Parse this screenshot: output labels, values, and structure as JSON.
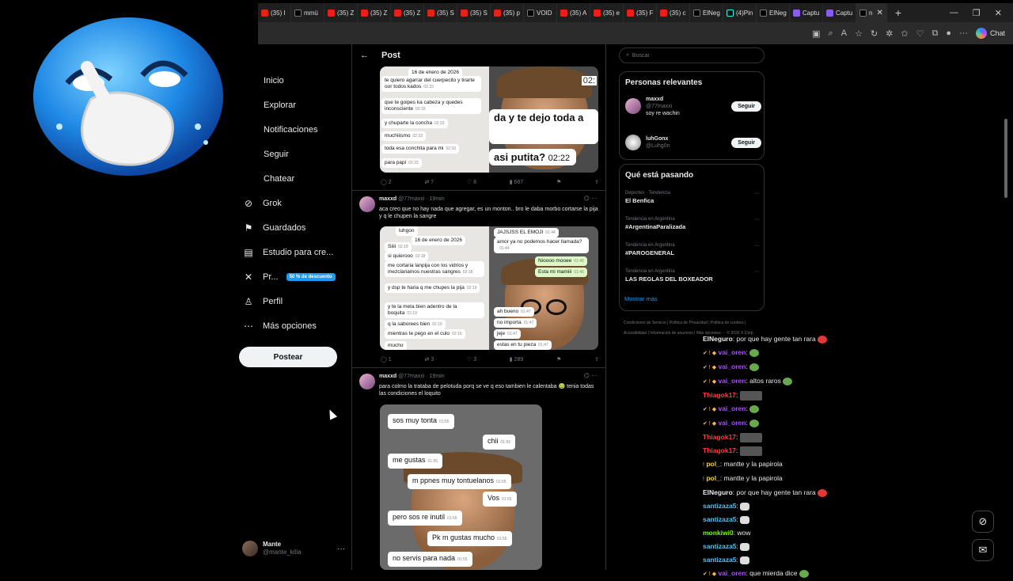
{
  "browser": {
    "tabs": [
      {
        "icon": "youtube",
        "label": "(35) I"
      },
      {
        "icon": "x",
        "label": "mmü"
      },
      {
        "icon": "youtube",
        "label": "(35) Z"
      },
      {
        "icon": "youtube",
        "label": "(35) Z"
      },
      {
        "icon": "youtube",
        "label": "(35) Z"
      },
      {
        "icon": "youtube",
        "label": "(35) S"
      },
      {
        "icon": "youtube",
        "label": "(35) S"
      },
      {
        "icon": "youtube",
        "label": "(35) p"
      },
      {
        "icon": "x",
        "label": "VOID"
      },
      {
        "icon": "youtube",
        "label": "(35) A"
      },
      {
        "icon": "youtube",
        "label": "(35) e"
      },
      {
        "icon": "youtube",
        "label": "(35) F"
      },
      {
        "icon": "youtube",
        "label": "(35) c"
      },
      {
        "icon": "x",
        "label": "ElNeg"
      },
      {
        "icon": "tiktok",
        "label": "(4)Pin"
      },
      {
        "icon": "x",
        "label": "ElNeg"
      },
      {
        "icon": "capture",
        "label": "Captu"
      },
      {
        "icon": "capture",
        "label": "Captu"
      }
    ],
    "active_tab_label": "n",
    "new_tab": "+",
    "chat_label": "Chat"
  },
  "nav": {
    "items": [
      {
        "label": "Inicio",
        "icon": ""
      },
      {
        "label": "Explorar",
        "icon": ""
      },
      {
        "label": "Notificaciones",
        "icon": ""
      },
      {
        "label": "Seguir",
        "icon": ""
      },
      {
        "label": "Chatear",
        "icon": ""
      },
      {
        "label": "Grok",
        "icon": "grok-icon"
      },
      {
        "label": "Guardados",
        "icon": "bookmark-icon"
      },
      {
        "label": "Estudio para cre...",
        "icon": "studio-icon"
      },
      {
        "label": "Pr...",
        "icon": "x-logo-icon"
      },
      {
        "label": "Perfil",
        "icon": "person-icon"
      },
      {
        "label": "Más opciones",
        "icon": "more-circle-icon"
      }
    ],
    "premium_badge": "50 % de descuento",
    "post_button": "Postear",
    "profile": {
      "name": "Mante",
      "handle": "@mante_kilia"
    }
  },
  "main": {
    "header_title": "Post",
    "tweet1": {
      "left_chat": [
        {
          "text": "16 de enero de 2026",
          "time": ""
        },
        {
          "text": "te quiero agarrar del cuerpecito y tirarte oor todos kados",
          "time": "02:33"
        },
        {
          "text": "que te goipes ka cabeza y quedes inconsciente",
          "time": "02:33"
        },
        {
          "text": "y chuparte la concha",
          "time": "02:33"
        },
        {
          "text": "muchiiismo",
          "time": "02:33"
        },
        {
          "text": "toda esa conchita para mi",
          "time": "02:33"
        },
        {
          "text": "para papi",
          "time": "02:33"
        }
      ],
      "right_chat": [
        {
          "text": "02:"
        },
        {
          "text": "da y te dejo toda a"
        },
        {
          "text": "asi putita?"
        },
        {
          "text": "02:22"
        }
      ],
      "stats": {
        "replies": "2",
        "reposts": "7",
        "likes": "8",
        "views": "667"
      }
    },
    "tweet2": {
      "author": "maxxd",
      "handle": "@77maxxi · 19min",
      "text": "aca creo que no hay nada que agregar, es un monton.. bro le daba morbo cortarse la pija y q le chupen la sangre",
      "left_chat": [
        {
          "text": "luhgon",
          "time": ""
        },
        {
          "text": "16 de enero de 2026",
          "time": ""
        },
        {
          "text": "Siiii",
          "time": "02:18"
        },
        {
          "text": "si quierooo",
          "time": "02:18"
        },
        {
          "text": "me cortaria lanpija con los vidrios y mezclariamos nuestras sangres",
          "time": "02:18"
        },
        {
          "text": "y dsp te haria q me chupes la pija",
          "time": "02:19"
        },
        {
          "text": "y te la meta bien adentro de la boquita",
          "time": "02:19"
        },
        {
          "text": "q la saborees bien",
          "time": "02:19"
        },
        {
          "text": "mientras te pego en el culo",
          "time": "02:19"
        },
        {
          "text": "mucho",
          "time": ""
        }
      ],
      "right_chat": [
        {
          "text": "JAJSJSS EL EMOJI",
          "time": "01:44"
        },
        {
          "text": "amor ya no podemos hacer llamada?",
          "time": "01:44"
        },
        {
          "text": "Nioooo mooee",
          "time": "01:46"
        },
        {
          "text": "Esta mi mamiii",
          "time": "01:46"
        },
        {
          "text": "ah bueno",
          "time": "01:47"
        },
        {
          "text": "no importa",
          "time": "01:47"
        },
        {
          "text": "jeje",
          "time": "01:47"
        },
        {
          "text": "estas en tu pieza",
          "time": "01:47"
        }
      ],
      "stats": {
        "replies": "1",
        "reposts": "3",
        "likes": "3",
        "views": "289"
      }
    },
    "tweet3": {
      "author": "maxxd",
      "handle": "@77maxxi · 19min",
      "text": "para colmo la trataba de pelotuda porq se ve q eso tambien le calentaba 🤢 tenia todas las condiciones el loquito",
      "chat": [
        {
          "text": "sos muy tonta",
          "time": "01:55"
        },
        {
          "text": "chii",
          "time": "01:55"
        },
        {
          "text": "me gustas",
          "time": "01:55"
        },
        {
          "text": "m ppnes muy tontuelanos",
          "time": "01:55"
        },
        {
          "text": "Vos",
          "time": "01:55"
        },
        {
          "text": "pero sos re inutil",
          "time": "01:55"
        },
        {
          "text": "Pk m gustas mucho",
          "time": "01:55"
        },
        {
          "text": "no servis para nada",
          "time": "01:55"
        }
      ]
    }
  },
  "right": {
    "search_placeholder": "Buscar",
    "relevant_title": "Personas relevantes",
    "people": [
      {
        "name": "maxxd",
        "handle": "@77maxxi",
        "bio": "soy re wachin",
        "follow": "Seguir"
      },
      {
        "name": "luhGonx",
        "handle": "@Luhg0n",
        "bio": "",
        "follow": "Seguir"
      }
    ],
    "trending_title": "Qué está pasando",
    "trends": [
      {
        "context": "Deportes · Tendencia",
        "name": "El Benfica"
      },
      {
        "context": "Tendencia en Argentina",
        "name": "#ArgentinaParalizada"
      },
      {
        "context": "Tendencia en Argentina",
        "name": "#PAROGENERAL"
      },
      {
        "context": "Tendencia en Argentina",
        "name": "LAS REGLAS DEL BOXEADOR"
      }
    ],
    "show_more": "Mostrar más",
    "footer": "Condiciones de Servicio | Política de Privacidad | Política de cookies | Accesibilidad | Información de anuncios | Más opciones ··· © 2026 X Corp."
  },
  "chat_overlay": [
    {
      "user": "ElNeguro",
      "color": "#e7e9ea",
      "badges": "",
      "msg": "por que hay gente tan rara",
      "emote": "red"
    },
    {
      "user": "vai_oren",
      "color": "#a64dff",
      "badges": "✔ ! ◆",
      "msg": "",
      "emote": "green"
    },
    {
      "user": "vai_oren",
      "color": "#a64dff",
      "badges": "✔ ! ◆",
      "msg": "",
      "emote": "green"
    },
    {
      "user": "vai_oren",
      "color": "#a64dff",
      "badges": "✔ ! ◆",
      "msg": "altos raros",
      "emote": "green"
    },
    {
      "user": "Thiagok17",
      "color": "#ff3b3b",
      "badges": "",
      "msg": "",
      "emote": "pic"
    },
    {
      "user": "vai_oren",
      "color": "#a64dff",
      "badges": "✔ ! ◆",
      "msg": "",
      "emote": "green"
    },
    {
      "user": "vai_oren",
      "color": "#a64dff",
      "badges": "✔ ! ◆",
      "msg": "",
      "emote": "green"
    },
    {
      "user": "Thiagok17",
      "color": "#ff3b3b",
      "badges": "",
      "msg": "",
      "emote": "pic"
    },
    {
      "user": "Thiagok17",
      "color": "#ff3b3b",
      "badges": "",
      "msg": "",
      "emote": "pic"
    },
    {
      "user": "pol_",
      "color": "#ffd400",
      "badges": "!",
      "msg": "mantte y la papirola",
      "emote": ""
    },
    {
      "user": "pol_",
      "color": "#ffd400",
      "badges": "!",
      "msg": "mantte y la papirola",
      "emote": ""
    },
    {
      "user": "ElNeguro",
      "color": "#e7e9ea",
      "badges": "",
      "msg": "por que hay gente tan rara",
      "emote": "red"
    },
    {
      "user": "santizaza5",
      "color": "#4fc3f7",
      "badges": "",
      "msg": "",
      "emote": "troll"
    },
    {
      "user": "santizaza5",
      "color": "#4fc3f7",
      "badges": "",
      "msg": "",
      "emote": "troll"
    },
    {
      "user": "monkiwi0",
      "color": "#7CFC00",
      "badges": "",
      "msg": "wow",
      "emote": ""
    },
    {
      "user": "santizaza5",
      "color": "#4fc3f7",
      "badges": "",
      "msg": "",
      "emote": "troll"
    },
    {
      "user": "santizaza5",
      "color": "#4fc3f7",
      "badges": "",
      "msg": "",
      "emote": "troll"
    },
    {
      "user": "vai_oren",
      "color": "#a64dff",
      "badges": "✔ ! ◆",
      "msg": "que mierda dice",
      "emote": "green"
    }
  ],
  "colors": {
    "accent": "#1d9bf0",
    "bg": "#000000",
    "text": "#e7e9ea",
    "muted": "#71767b",
    "border": "#2f3336"
  }
}
